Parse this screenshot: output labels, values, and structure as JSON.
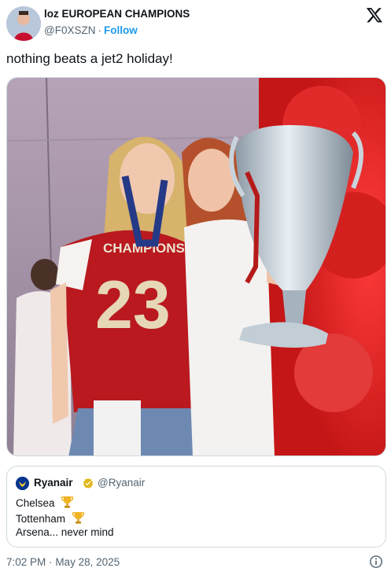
{
  "author": {
    "display_name": "loz EUROPEAN CHAMPIONS",
    "handle": "@F0XSZN",
    "separator": "·",
    "follow_label": "Follow"
  },
  "tweet": {
    "text": "nothing beats a jet2 holiday!",
    "photo_jersey_number": "23",
    "photo_jersey_text": "CHAMPIONS"
  },
  "quote": {
    "name": "Ryanair",
    "handle": "@Ryanair",
    "lines": [
      "Chelsea",
      "Tottenham",
      "Arsena... never mind"
    ],
    "line_icons": [
      "trophy-icon",
      "trophy-icon",
      ""
    ]
  },
  "meta": {
    "time": "7:02 PM",
    "separator": "·",
    "date": "May 28, 2025"
  },
  "icons": [
    "x-logo-icon",
    "verified-badge-icon",
    "trophy-icon",
    "info-icon"
  ],
  "colors": {
    "link": "#1d9bf0",
    "secondary_text": "#536471",
    "border": "#cfd9de",
    "ryanair_blue": "#073590",
    "badge_gold": "#e2b719"
  }
}
